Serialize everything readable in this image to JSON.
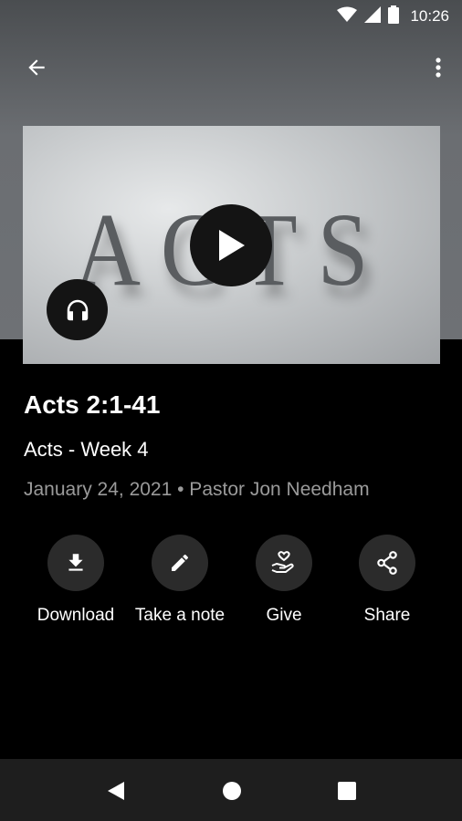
{
  "status_bar": {
    "time": "10:26"
  },
  "media": {
    "artwork_text": "ACTS"
  },
  "sermon": {
    "title": "Acts 2:1-41",
    "series": "Acts - Week 4",
    "meta": "January 24, 2021 • Pastor Jon Needham"
  },
  "actions": [
    {
      "label": "Download",
      "icon": "download-icon"
    },
    {
      "label": "Take a note",
      "icon": "pencil-icon"
    },
    {
      "label": "Give",
      "icon": "hand-heart-icon"
    },
    {
      "label": "Share",
      "icon": "share-icon"
    }
  ],
  "colors": {
    "header": "#6e7175",
    "background": "#000000",
    "button": "#2b2b2b",
    "muted_text": "#9a9a9a",
    "nav_bar": "#1e1e1e"
  }
}
